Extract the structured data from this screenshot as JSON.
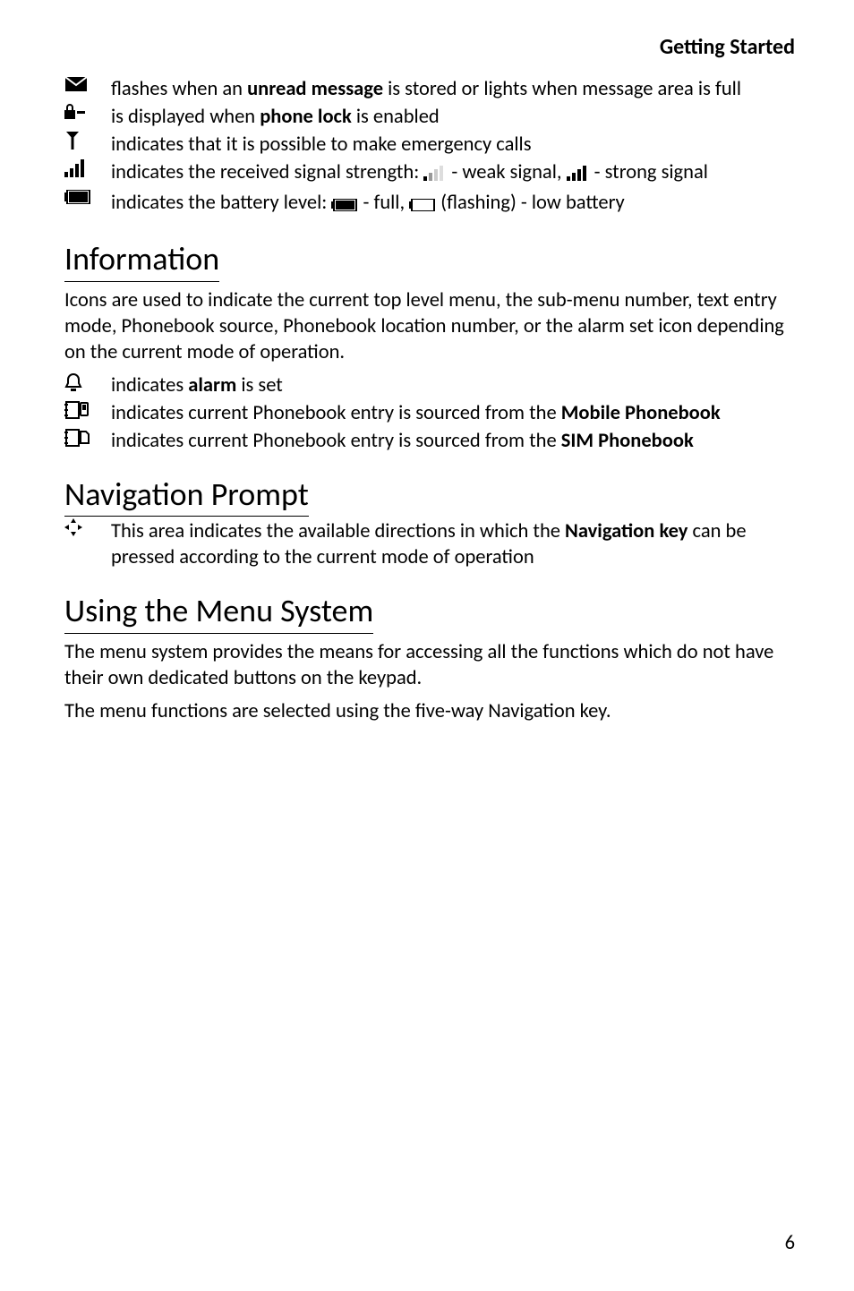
{
  "header": "Getting Started",
  "top_icons": [
    {
      "icon": "envelope-icon",
      "text_parts": [
        "flashes when an ",
        "unread message",
        " is stored or lights when message area is full"
      ],
      "bold_indices": [
        1
      ]
    },
    {
      "icon": "lock-icon",
      "text_parts": [
        "is displayed when ",
        "phone lock",
        " is enabled"
      ],
      "bold_indices": [
        1
      ]
    },
    {
      "icon": "antenna-icon",
      "text_parts": [
        "indicates that it is possible to make emergency calls"
      ],
      "bold_indices": []
    },
    {
      "icon": "signal-bars-icon",
      "text_before": "indicates the received signal strength: ",
      "mid1_icon": "weak-signal-icon",
      "mid1_text": " - weak signal, ",
      "mid2_icon": "strong-signal-icon",
      "mid2_text": " - strong signal"
    },
    {
      "icon": "battery-icon",
      "text_before": "indicates the battery level:  ",
      "mid1_icon": "battery-full-icon",
      "mid1_text": " - full, ",
      "mid2_icon": "battery-empty-icon",
      "mid2_text": " (flashing) - low battery"
    }
  ],
  "information": {
    "title": "Information",
    "intro": "Icons are used to indicate the current top level menu, the sub-menu number, text entry mode, Phonebook source, Phonebook location number, or the alarm set icon depending on the current mode of operation.",
    "rows": [
      {
        "icon": "alarm-bell-icon",
        "text_parts": [
          "indicates ",
          "alarm",
          " is set"
        ],
        "bold_indices": [
          1
        ]
      },
      {
        "icon": "mobile-phonebook-icon",
        "text_parts": [
          "indicates current Phonebook entry is sourced from the ",
          "Mobile Phonebook"
        ],
        "bold_indices": [
          1
        ]
      },
      {
        "icon": "sim-phonebook-icon",
        "text_parts": [
          "indicates current Phonebook entry is sourced from the ",
          "SIM Phonebook"
        ],
        "bold_indices": [
          1
        ]
      }
    ]
  },
  "navigation_prompt": {
    "title": "Navigation Prompt",
    "rows": [
      {
        "icon": "nav-arrows-icon",
        "text_parts": [
          "This area indicates the available directions in which the ",
          "Navigation key",
          " can be pressed according to the current mode of operation"
        ],
        "bold_indices": [
          1
        ]
      }
    ]
  },
  "using_menu": {
    "title": "Using the Menu System",
    "para1": "The menu system provides the means for accessing all the functions which do not have their own dedicated buttons on the keypad.",
    "para2_parts": [
      "The menu functions are selected using the five-way ",
      "Navigation key",
      "."
    ],
    "para2_bold_indices": [
      1
    ]
  },
  "page_number": "6"
}
